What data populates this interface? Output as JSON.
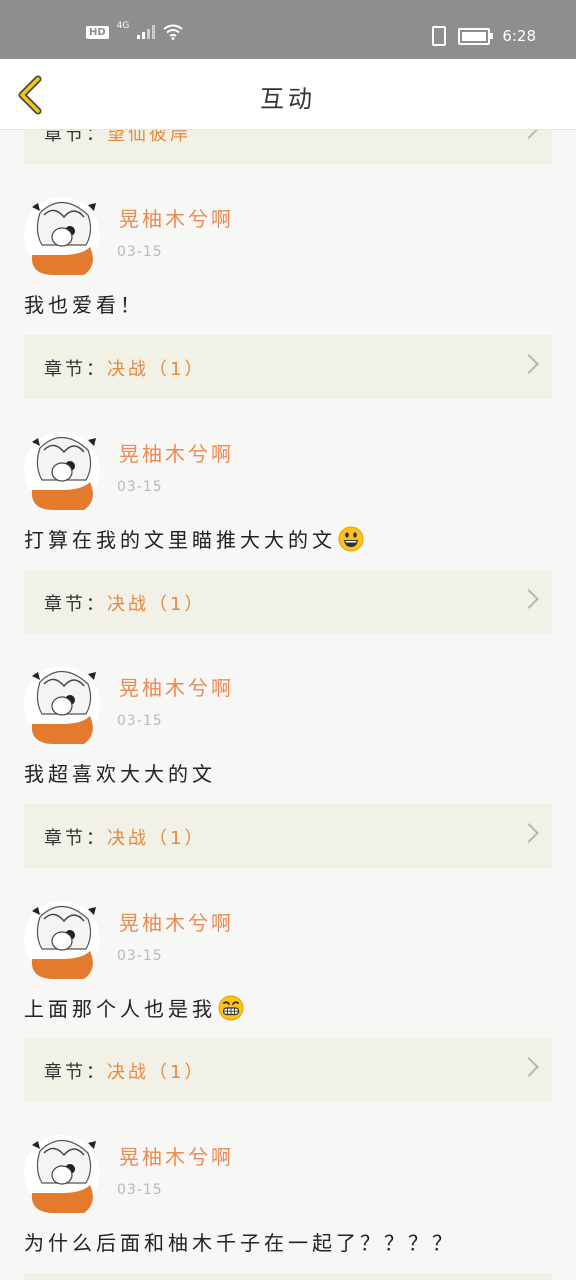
{
  "status_bar": {
    "hd": "HD",
    "network": "4G",
    "time": "6:28"
  },
  "header": {
    "title": "互动"
  },
  "chapter_prefix": "章节：",
  "top_partial_chapter": {
    "name": "望仙彼岸"
  },
  "posts": [
    {
      "username": "晃柚木兮啊",
      "date": "03-15",
      "comment": "我也爱看！",
      "emoji": "",
      "chapter": "决战（1）"
    },
    {
      "username": "晃柚木兮啊",
      "date": "03-15",
      "comment": "打算在我的文里瞄推大大的文",
      "emoji": "grinning-face",
      "chapter": "决战（1）"
    },
    {
      "username": "晃柚木兮啊",
      "date": "03-15",
      "comment": "我超喜欢大大的文",
      "emoji": "",
      "chapter": "决战（1）"
    },
    {
      "username": "晃柚木兮啊",
      "date": "03-15",
      "comment": "上面那个人也是我",
      "emoji": "grimacing-face",
      "chapter": "决战（1）"
    },
    {
      "username": "晃柚木兮啊",
      "date": "03-15",
      "comment": "为什么后面和柚木千子在一起了？？？？",
      "emoji": "",
      "chapter": ""
    }
  ]
}
